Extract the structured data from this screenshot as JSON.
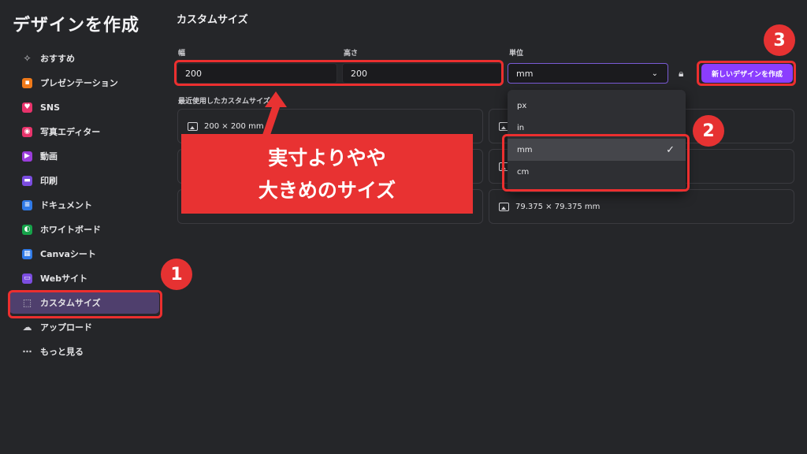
{
  "sidebar": {
    "title": "デザインを作成",
    "items": [
      {
        "label": "おすすめ",
        "icon": "sparkle-icon",
        "color": "transparent"
      },
      {
        "label": "プレゼンテーション",
        "icon": "presentation-icon",
        "color": "#f07a1a"
      },
      {
        "label": "SNS",
        "icon": "heart-icon",
        "color": "#e8336b"
      },
      {
        "label": "写真エディター",
        "icon": "camera-icon",
        "color": "#e8336b"
      },
      {
        "label": "動画",
        "icon": "video-icon",
        "color": "#9b3ddb"
      },
      {
        "label": "印刷",
        "icon": "printer-icon",
        "color": "#7b4de0"
      },
      {
        "label": "ドキュメント",
        "icon": "document-icon",
        "color": "#2f7ae8"
      },
      {
        "label": "ホワイトボード",
        "icon": "whiteboard-icon",
        "color": "#16a34a"
      },
      {
        "label": "Canvaシート",
        "icon": "sheet-icon",
        "color": "#2f7ae8"
      },
      {
        "label": "Webサイト",
        "icon": "website-icon",
        "color": "#7b4de0"
      },
      {
        "label": "カスタムサイズ",
        "icon": "custom-size-icon",
        "color": "transparent",
        "active": true
      },
      {
        "label": "アップロード",
        "icon": "upload-cloud-icon",
        "color": "transparent"
      },
      {
        "label": "もっと見る",
        "icon": "more-icon",
        "color": "transparent"
      }
    ]
  },
  "main": {
    "title": "カスタムサイズ",
    "width_label": "幅",
    "width_value": "200",
    "height_label": "高さ",
    "height_value": "200",
    "unit_label": "単位",
    "unit_value": "mm",
    "create_button": "新しいデザインを作成",
    "recent_label": "最近使用したカスタムサイズ",
    "recent_left": [
      "200 × 200 mm",
      "",
      ""
    ],
    "recent_right": [
      "",
      "",
      "79.375 × 79.375 mm"
    ]
  },
  "dropdown": {
    "options": [
      "px",
      "in",
      "mm",
      "cm"
    ],
    "selected": "mm"
  },
  "annotations": {
    "badge1": "1",
    "badge2": "2",
    "badge3": "3",
    "callout_line1": "実寸よりやや",
    "callout_line2": "大きめのサイズ"
  },
  "colors": {
    "accent": "#8b3dff",
    "annotation_red": "#e83232",
    "background": "#252629"
  }
}
